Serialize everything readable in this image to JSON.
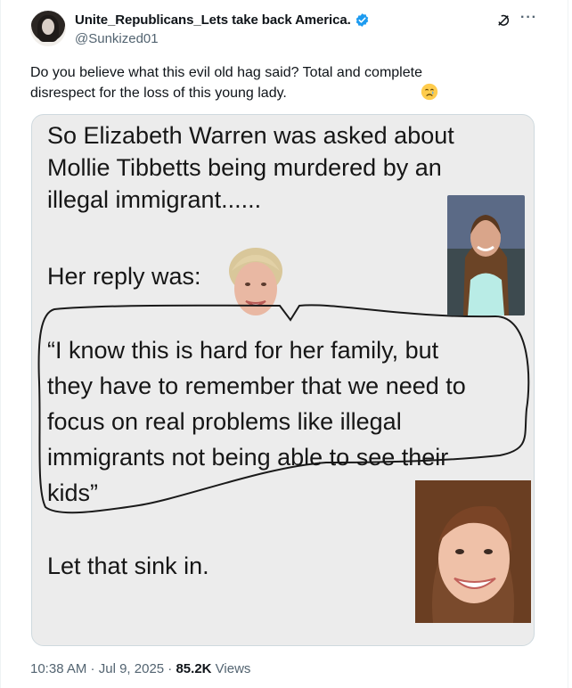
{
  "post": {
    "author_name": "Unite_Republicans_Lets take back America.",
    "handle": "@Sunkized01",
    "text_line1": "Do you believe what this evil old hag said?  Total and complete",
    "text_line2": "disrespect for the loss of this young lady.",
    "emoji_name": "crying-face-emoji",
    "more_label": "···"
  },
  "meme": {
    "line1": "So Elizabeth Warren was asked about",
    "line2": "Mollie Tibbetts being murdered by an",
    "line3": "illegal immigrant......",
    "reply": "Her reply was:",
    "quote1": "“I know this is hard for her family, but",
    "quote2": "they have to remember that we need to",
    "quote3": "focus on real problems like illegal",
    "quote4": "immigrants not being able to see their",
    "quote5": "kids”",
    "closing": "Let that sink in."
  },
  "footer": {
    "time": "10:38 AM",
    "separator1": " · ",
    "date": "Jul 9, 2025",
    "separator2": " · ",
    "views_count": "85.2K",
    "views_label": " Views"
  },
  "colors": {
    "verified_blue": "#1d9bf0",
    "secondary_text": "#536471",
    "primary_text": "#0f1419"
  }
}
